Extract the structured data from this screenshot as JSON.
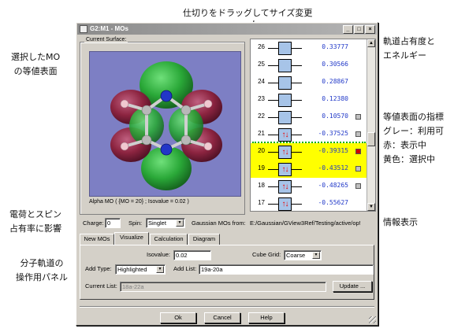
{
  "annotations": {
    "divider": "仕切りをドラッグしてサイズ変更",
    "selected_mo": "選択したMO\nの等値表面",
    "occupancy": "軌道占有度と\nエネルギー",
    "surface_indicator": "等値表面の指標\nグレー：利用可\n赤：表示中\n黄色：選択中",
    "charge_spin": "電荷とスピン\n占有率に影響",
    "info_display": "情報表示",
    "mo_panel": "分子軌道の\n操作用パネル"
  },
  "window": {
    "title": "G2:M1 - MOs",
    "controls": [
      "_",
      "□",
      "×"
    ]
  },
  "surface": {
    "legend": "Current Surface:",
    "caption": "Alpha MO ( {MO = 20} ; Isovalue = 0.02 )"
  },
  "mo_list": [
    {
      "n": "26",
      "energy": "0.33777",
      "occ": "",
      "indicator": "none",
      "selected": false
    },
    {
      "n": "25",
      "energy": "0.30566",
      "occ": "",
      "indicator": "none",
      "selected": false
    },
    {
      "n": "24",
      "energy": "0.28867",
      "occ": "",
      "indicator": "none",
      "selected": false
    },
    {
      "n": "23",
      "energy": "0.12380",
      "occ": "",
      "indicator": "none",
      "selected": false
    },
    {
      "n": "22",
      "energy": "0.10570",
      "occ": "",
      "indicator": "gray",
      "selected": false
    },
    {
      "n": "21",
      "energy": "-0.37525",
      "occ": "↑↓",
      "indicator": "gray",
      "selected": false
    },
    {
      "n": "20",
      "energy": "-0.39315",
      "occ": "↑↓",
      "indicator": "red",
      "selected": true
    },
    {
      "n": "19",
      "energy": "-0.43512",
      "occ": "↑↓",
      "indicator": "gray",
      "selected": true
    },
    {
      "n": "18",
      "energy": "-0.48265",
      "occ": "↑↓",
      "indicator": "gray",
      "selected": false
    },
    {
      "n": "17",
      "energy": "-0.55627",
      "occ": "↑↓",
      "indicator": "none",
      "selected": false
    }
  ],
  "colors": {
    "indicator_gray": "#c0c0c0",
    "indicator_red": "#cc0000",
    "selected_yellow": "#ffff00",
    "energy_blue": "#2038c8",
    "homo_lumo_line": "#00b000"
  },
  "charge": {
    "label": "Charge:",
    "value": "0"
  },
  "spin": {
    "label": "Spin:",
    "value": "Singlet"
  },
  "source": {
    "label": "Gaussian MOs from:",
    "path": "E:/Gaussian/GView3Ref/Testing/active/op!"
  },
  "tabs": [
    {
      "label": "New MOs",
      "active": false
    },
    {
      "label": "Visualize",
      "active": true
    },
    {
      "label": "Calculation",
      "active": false
    },
    {
      "label": "Diagram",
      "active": false
    }
  ],
  "visualize": {
    "isovalue_label": "Isovalue:",
    "isovalue": "0.02",
    "cubegrid_label": "Cube Grid:",
    "cubegrid": "Coarse",
    "addtype_label": "Add Type:",
    "addtype": "Highlighted",
    "addlist_label": "Add List:",
    "addlist": "19a-20a",
    "currentlist_label": "Current List:",
    "currentlist": "18a-22a",
    "update_label": "Update ..."
  },
  "buttons": {
    "ok": "Ok",
    "cancel": "Cancel",
    "help": "Help"
  }
}
